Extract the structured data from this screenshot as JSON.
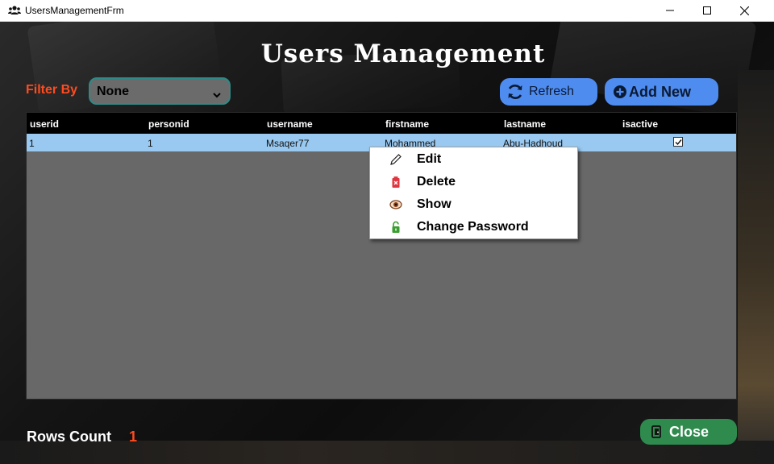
{
  "window": {
    "title": "UsersManagementFrm",
    "icon": "users-icon"
  },
  "header": {
    "title": "Users Management"
  },
  "filter": {
    "label": "Filter By",
    "selected": "None"
  },
  "toolbar": {
    "refresh_label": "Refresh",
    "add_label": "Add New"
  },
  "grid": {
    "columns": [
      "userid",
      "personid",
      "username",
      "firstname",
      "lastname",
      "isactive"
    ],
    "rows": [
      {
        "userid": "1",
        "personid": "1",
        "username": "Msaqer77",
        "firstname": "Mohammed",
        "lastname": "Abu-Hadhoud",
        "isactive": true
      }
    ]
  },
  "context_menu": {
    "items": [
      {
        "label": "Edit",
        "icon": "pencil-icon"
      },
      {
        "label": "Delete",
        "icon": "trash-icon"
      },
      {
        "label": "Show",
        "icon": "eye-icon"
      },
      {
        "label": "Change Password",
        "icon": "lock-icon"
      }
    ]
  },
  "footer": {
    "rows_count_label": "Rows Count",
    "rows_count_value": "1",
    "close_label": "Close"
  },
  "colors": {
    "accent_orange": "#ff4b1f",
    "button_blue": "#4f8cf0",
    "button_green": "#2e8a4d",
    "row_selected": "#99c9f0",
    "grid_bg": "#686868"
  }
}
